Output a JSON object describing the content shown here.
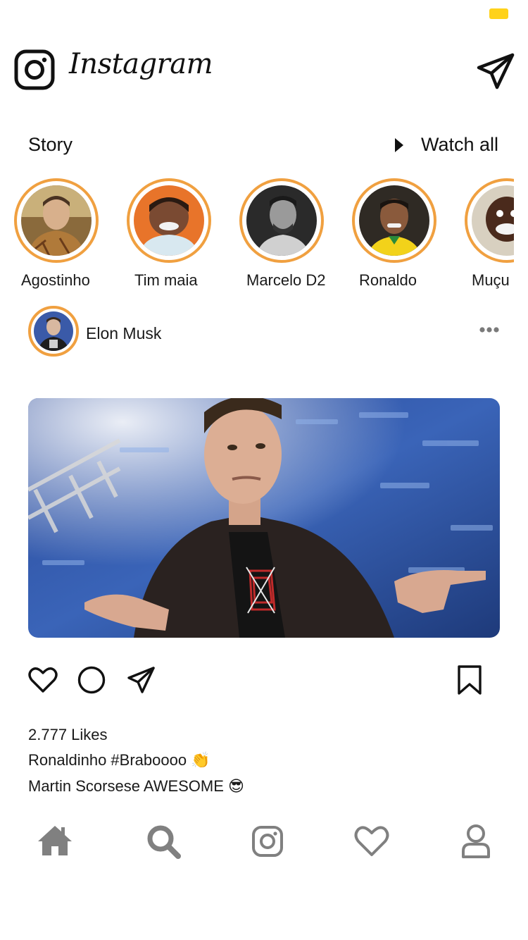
{
  "app": {
    "title": "Instagram"
  },
  "icons": {
    "logo": "instagram-camera-icon",
    "direct": "paper-plane-icon",
    "watch_all": "play-icon",
    "more": "more-dots-icon",
    "like": "heart-icon",
    "comment": "circle-comment-icon",
    "share": "paper-plane-icon",
    "save": "bookmark-icon"
  },
  "stories": {
    "title": "Story",
    "watch_all_label": "Watch all",
    "items": [
      {
        "name": "Agostinho"
      },
      {
        "name": "Tim maia"
      },
      {
        "name": "Marcelo D2"
      },
      {
        "name": "Ronaldo"
      },
      {
        "name": "Muçu"
      }
    ]
  },
  "post": {
    "username": "Elon Musk",
    "likes": "2.777 Likes",
    "caption_lines": [
      "Ronaldinho #Braboooo 👏",
      "Martin Scorsese AWESOME 😎"
    ]
  },
  "bottom_nav": {
    "items": [
      {
        "icon": "home-icon"
      },
      {
        "icon": "search-icon"
      },
      {
        "icon": "instagram-camera-icon"
      },
      {
        "icon": "heart-icon"
      },
      {
        "icon": "profile-icon"
      }
    ]
  },
  "colors": {
    "story_ring": "#f0a040",
    "nav_icon": "#808080",
    "battery": "#ffd21a"
  }
}
